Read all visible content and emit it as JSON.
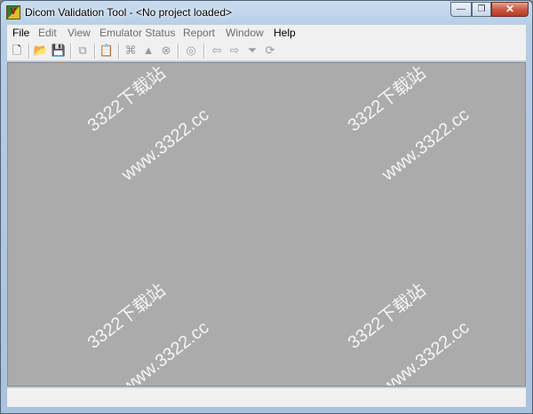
{
  "window": {
    "title": "Dicom Validation Tool - <No project loaded>",
    "app_icon_glyph": "V",
    "controls": {
      "minimize": "—",
      "maximize": "❐",
      "close": "✕"
    }
  },
  "menu": [
    {
      "label": "File",
      "enabled": true
    },
    {
      "label": "Edit",
      "enabled": false
    },
    {
      "label": "View",
      "enabled": false
    },
    {
      "label": "Emulator Status",
      "enabled": false
    },
    {
      "label": "Report",
      "enabled": false
    },
    {
      "label": "Window",
      "enabled": false
    },
    {
      "label": "Help",
      "enabled": true
    }
  ],
  "toolbar": [
    {
      "icon": "new-file-icon",
      "glyph": "🗋",
      "enabled": true
    },
    {
      "icon": "open-folder-icon",
      "glyph": "📂",
      "enabled": true
    },
    {
      "icon": "save-icon",
      "glyph": "💾",
      "enabled": false
    },
    {
      "icon": "copy-icon",
      "glyph": "⧉",
      "enabled": false
    },
    {
      "icon": "paste-icon",
      "glyph": "📋",
      "enabled": false
    },
    {
      "icon": "binoculars-icon",
      "glyph": "⌘",
      "enabled": false
    },
    {
      "icon": "triangle-warning-icon",
      "glyph": "▲",
      "enabled": false
    },
    {
      "icon": "stop-icon",
      "glyph": "⊗",
      "enabled": false
    },
    {
      "icon": "validate-icon",
      "glyph": "◎",
      "enabled": false
    },
    {
      "icon": "arrow-left-icon",
      "glyph": "⇦",
      "enabled": false
    },
    {
      "icon": "arrow-right-icon",
      "glyph": "⇨",
      "enabled": false
    },
    {
      "icon": "filter-icon",
      "glyph": "⏷",
      "enabled": false
    },
    {
      "icon": "refresh-icon",
      "glyph": "⟳",
      "enabled": false
    }
  ],
  "watermark": {
    "brand": "3322下载站",
    "url": "www.3322.cc"
  }
}
